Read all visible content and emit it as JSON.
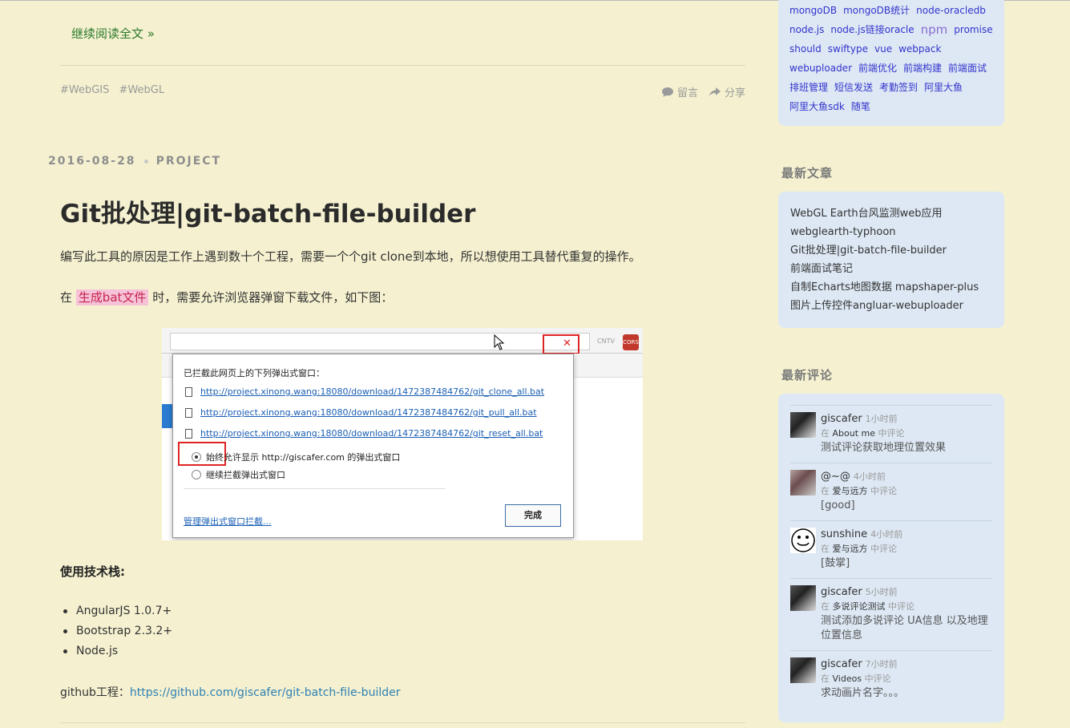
{
  "post_prev": {
    "read_more": "继续阅读全文 »",
    "tags": [
      "#WebGIS",
      "#WebGL"
    ],
    "comment_label": "留言",
    "share_label": "分享"
  },
  "post": {
    "date": "2016-08-28",
    "category": "PROJECT",
    "title": "Git批处理|git-batch-file-builder",
    "para1": "编写此工具的原因是工作上遇到数十个工程，需要一个个git clone到本地，所以想使用工具替代重复的操作。",
    "para2_prefix": "在",
    "para2_code": "生成bat文件",
    "para2_suffix": "时，需要允许浏览器弹窗下载文件，如下图：",
    "stack_title": "使用技术栈:",
    "stack": [
      "AngularJS 1.0.7+",
      "Bootstrap 2.3.2+",
      "Node.js"
    ],
    "github_label": "github工程：",
    "github_url": "https://github.com/giscafer/git-batch-file-builder"
  },
  "screenshot": {
    "header": "已拦截此网页上的下列弹出式窗口：",
    "links": [
      "http://project.xinong.wang:18080/download/1472387484762/git_clone_all.bat",
      "http://project.xinong.wang:18080/download/1472387484762/git_pull_all.bat",
      "http://project.xinong.wang:18080/download/1472387484762/git_reset_all.bat"
    ],
    "option_allow": "始终允许显示 http://giscafer.com 的弹出式窗口",
    "option_block": "继续拦截弹出式窗口",
    "manage": "管理弹出式窗口拦截...",
    "done": "完成",
    "cors": "CORS",
    "cntv": "CNTV"
  },
  "sidebar": {
    "tag_cloud": [
      {
        "label": "mongoDB",
        "big": false
      },
      {
        "label": "mongoDB统计",
        "big": false
      },
      {
        "label": "node-oracledb",
        "big": false
      },
      {
        "label": "node.js",
        "big": false
      },
      {
        "label": "node.js链接oracle",
        "big": false
      },
      {
        "label": "npm",
        "big": true
      },
      {
        "label": "promise",
        "big": false
      },
      {
        "label": "should",
        "big": false
      },
      {
        "label": "swiftype",
        "big": false
      },
      {
        "label": "vue",
        "big": false
      },
      {
        "label": "webpack",
        "big": false
      },
      {
        "label": "webuploader",
        "big": false
      },
      {
        "label": "前端优化",
        "big": false
      },
      {
        "label": "前端构建",
        "big": false
      },
      {
        "label": "前端面试",
        "big": false
      },
      {
        "label": "排班管理",
        "big": false
      },
      {
        "label": "短信发送",
        "big": false
      },
      {
        "label": "考勤签到",
        "big": false
      },
      {
        "label": "阿里大鱼",
        "big": false
      },
      {
        "label": "阿里大鱼sdk",
        "big": false
      },
      {
        "label": "随笔",
        "big": false
      }
    ],
    "recent_title": "最新文章",
    "recent_posts": [
      "WebGL Earth台风监测web应用",
      "webglearth-typhoon",
      "Git批处理|git-batch-file-builder",
      "前端面试笔记",
      "自制Echarts地图数据 mapshaper-plus",
      "图片上传控件angluar-webuploader"
    ],
    "comments_title": "最新评论",
    "comments": [
      {
        "user": "giscafer",
        "time": "1小时前",
        "in": "在",
        "article": "About me",
        "suffix": "中评论",
        "text": "测试评论获取地理位置效果"
      },
      {
        "user": "@~@",
        "time": "4小时前",
        "in": "在",
        "article": "爱与远方",
        "suffix": "中评论",
        "text": "[good]"
      },
      {
        "user": "sunshine",
        "time": "4小时前",
        "in": "在",
        "article": "爱与远方",
        "suffix": "中评论",
        "text": "[鼓掌]"
      },
      {
        "user": "giscafer",
        "time": "5小时前",
        "in": "在",
        "article": "多说评论测试",
        "suffix": "中评论",
        "text": "测试添加多说评论 UA信息 以及地理位置信息"
      },
      {
        "user": "giscafer",
        "time": "7小时前",
        "in": "在",
        "article": "Videos",
        "suffix": "中评论",
        "text": "求动画片名字。。。"
      }
    ]
  }
}
